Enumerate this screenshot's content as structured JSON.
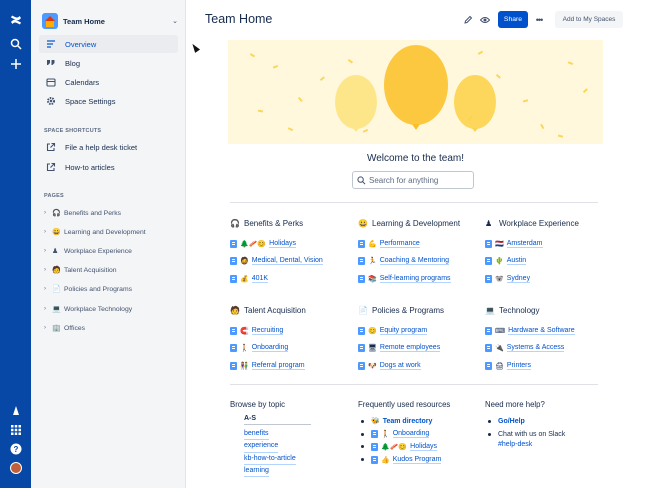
{
  "rail": {
    "icons": [
      "confluence-logo-icon",
      "search-icon",
      "create-icon",
      "notifications-icon",
      "app-switcher-icon",
      "help-icon",
      "profile-avatar"
    ]
  },
  "sidebar": {
    "space_name": "Team Home",
    "nav": [
      {
        "label": "Overview",
        "icon": "overview-icon",
        "active": true
      },
      {
        "label": "Blog",
        "icon": "blog-icon"
      },
      {
        "label": "Calendars",
        "icon": "calendar-icon"
      },
      {
        "label": "Space Settings",
        "icon": "gear-icon"
      }
    ],
    "shortcuts_label": "SPACE SHORTCUTS",
    "shortcuts": [
      {
        "label": "File a help desk ticket",
        "icon": "external-link-icon"
      },
      {
        "label": "How-to articles",
        "icon": "external-link-icon"
      }
    ],
    "pages_label": "PAGES",
    "pages": [
      {
        "emoji": "🎧",
        "label": "Benefits and Perks"
      },
      {
        "emoji": "😀",
        "label": "Learning and Development"
      },
      {
        "emoji": "♟",
        "label": "Workplace Experience"
      },
      {
        "emoji": "🧑",
        "label": "Talent Acquisition"
      },
      {
        "emoji": "📄",
        "label": "Policies and Programs"
      },
      {
        "emoji": "💻",
        "label": "Workplace Technology"
      },
      {
        "emoji": "🏢",
        "label": "Offices"
      }
    ]
  },
  "header": {
    "title": "Team Home",
    "share_label": "Share",
    "more_label": "•••",
    "add_label": "Add to My Spaces"
  },
  "main": {
    "welcome": "Welcome to the team!",
    "search_placeholder": "Search for anything",
    "categories": [
      {
        "emoji": "🎧",
        "title": "Benefits & Perks",
        "links": [
          {
            "emoji": "🌲🥓😊",
            "text": "Holidays"
          },
          {
            "emoji": "🧔",
            "text": "Medical, Dental, Vision"
          },
          {
            "emoji": "💰",
            "text": "401K"
          }
        ]
      },
      {
        "emoji": "😀",
        "title": "Learning & Development",
        "links": [
          {
            "emoji": "💪",
            "text": "Performance"
          },
          {
            "emoji": "🏃",
            "text": "Coaching & Mentoring"
          },
          {
            "emoji": "📚",
            "text": "Self-learning programs"
          }
        ]
      },
      {
        "emoji": "♟",
        "title": "Workplace Experience",
        "links": [
          {
            "emoji": "🇳🇱",
            "text": "Amsterdam"
          },
          {
            "emoji": "🌵",
            "text": "Austin"
          },
          {
            "emoji": "🐨",
            "text": "Sydney"
          }
        ]
      },
      {
        "emoji": "🧑",
        "title": "Talent Acquisition",
        "links": [
          {
            "emoji": "🧲",
            "text": "Recruiting"
          },
          {
            "emoji": "🚶",
            "text": "Onboarding"
          },
          {
            "emoji": "👫",
            "text": "Referral program"
          }
        ]
      },
      {
        "emoji": "📄",
        "title": "Policies & Programs",
        "links": [
          {
            "emoji": "😊",
            "text": "Equity program"
          },
          {
            "emoji": "🖥",
            "text": "Remote employees"
          },
          {
            "emoji": "🐶",
            "text": "Dogs at work"
          }
        ]
      },
      {
        "emoji": "💻",
        "title": "Technology",
        "links": [
          {
            "emoji": "⌨",
            "text": "Hardware & Software"
          },
          {
            "emoji": "🔌",
            "text": "Systems & Access"
          },
          {
            "emoji": "🖨",
            "text": "Printers"
          }
        ]
      }
    ],
    "browse": {
      "title": "Browse by topic",
      "head": "A-S",
      "topics": [
        "benefits",
        "experience",
        "kb-how-to-article",
        "learning"
      ]
    },
    "resources": {
      "title": "Frequently used resources",
      "items": [
        {
          "emoji": "🐝",
          "text": "Team directory",
          "page": false,
          "bold": true
        },
        {
          "emoji": "🚶",
          "text": "Onboarding",
          "page": true
        },
        {
          "emoji": "🌲🥓😊",
          "text": "Holidays",
          "page": true
        },
        {
          "emoji": "👍",
          "text": "Kudos Program",
          "page": true
        }
      ]
    },
    "help": {
      "title": "Need more help?",
      "items": [
        {
          "text": "Go/Help",
          "link": true
        },
        {
          "text": "Chat with us on Slack",
          "link": false
        }
      ],
      "sub": "#help-desk"
    }
  }
}
